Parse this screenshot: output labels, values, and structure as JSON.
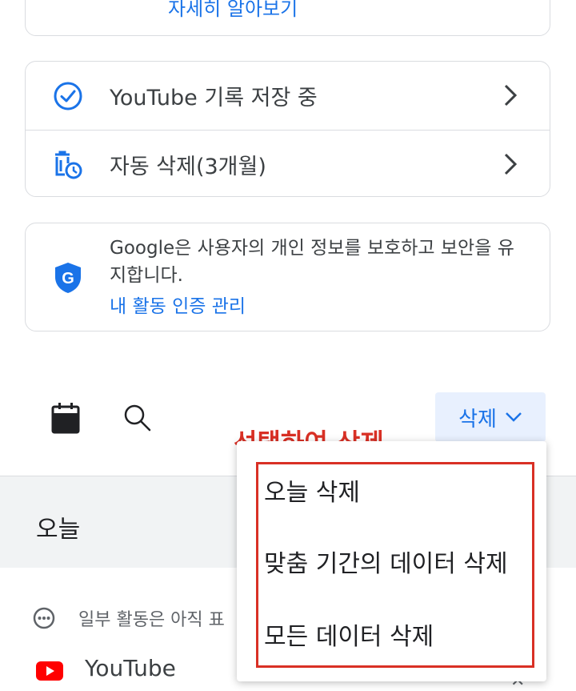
{
  "top_card": {
    "link": "자세히 알아보기"
  },
  "settings": [
    {
      "label": "YouTube 기록 저장 중",
      "icon": "check-circle-icon"
    },
    {
      "label": "자동 삭제(3개월)",
      "icon": "auto-delete-icon"
    }
  ],
  "privacy": {
    "text": "Google은 사용자의 개인 정보를 보호하고 보안을 유지합니다.",
    "link": "내 활동 인증 관리"
  },
  "toolbar": {
    "delete_label": "삭제"
  },
  "annotation": "선택하여 삭제",
  "menu": {
    "items": [
      "오늘 삭제",
      "맞춤 기간의 데이터 삭제",
      "모든 데이터 삭제"
    ]
  },
  "feed": {
    "today_label": "오늘",
    "info_text": "일부 활동은 아직 표",
    "app_label": "YouTube"
  },
  "colors": {
    "accent": "#1a73e8",
    "annotation": "#d93025"
  }
}
